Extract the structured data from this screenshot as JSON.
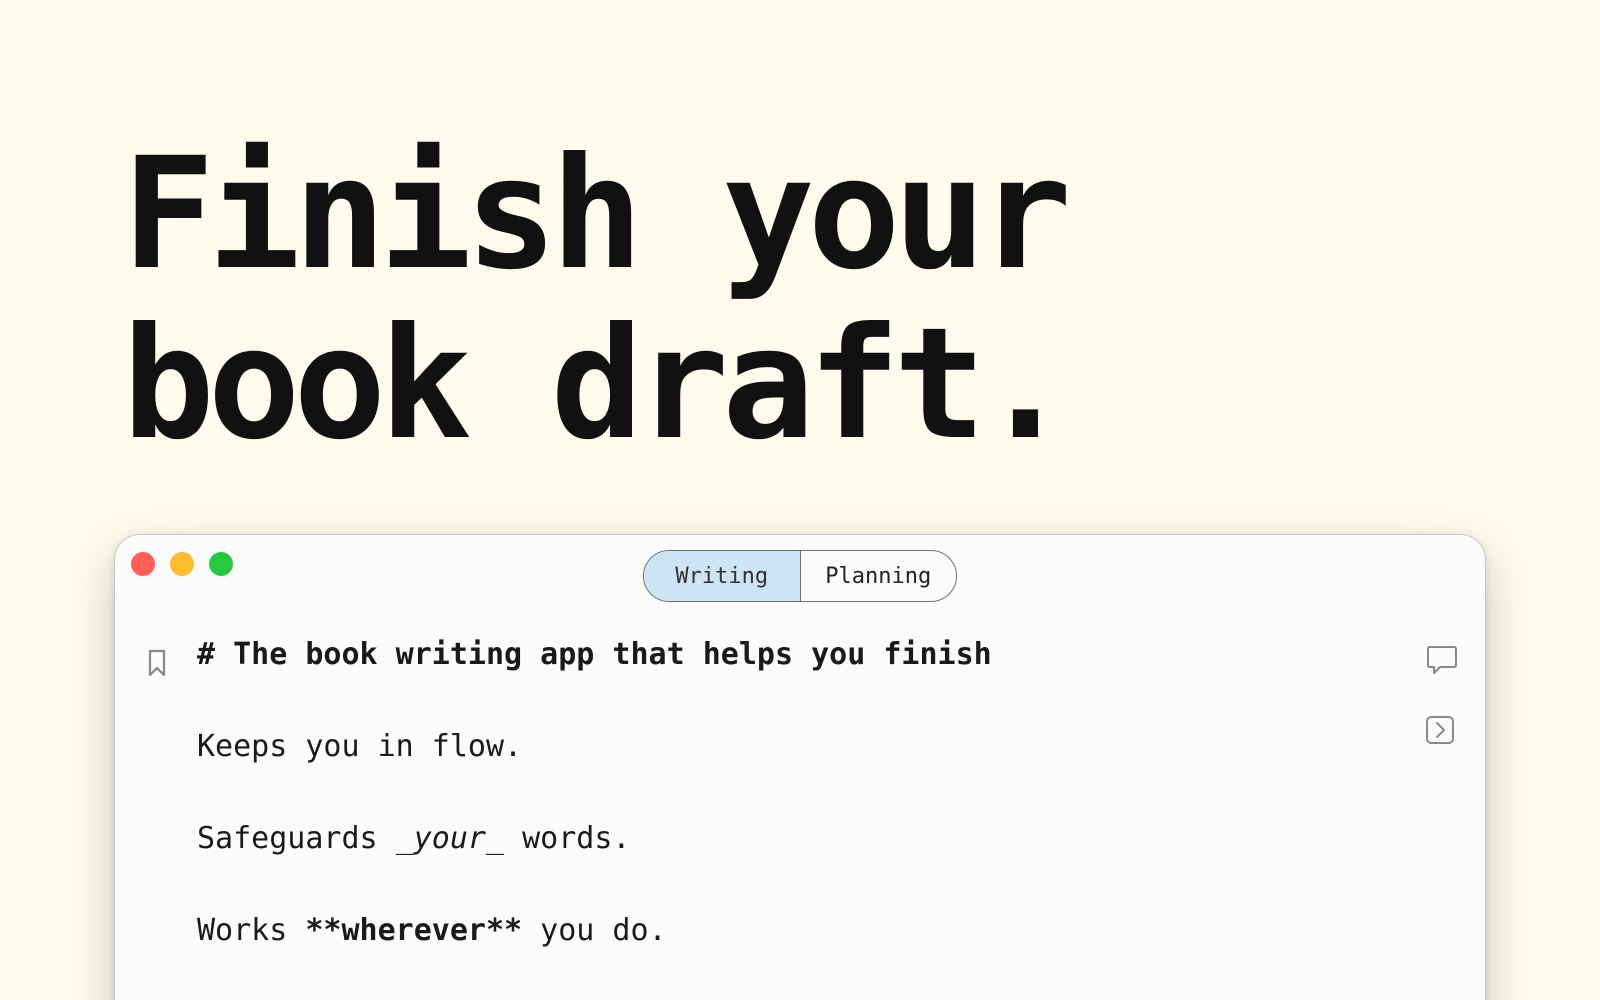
{
  "hero": {
    "line1": "Finish your",
    "line2": "book draft."
  },
  "window": {
    "tabs": [
      {
        "label": "Writing",
        "active": true
      },
      {
        "label": "Planning",
        "active": false
      }
    ],
    "traffic_colors": {
      "close": "#ff5f57",
      "minimize": "#febc2e",
      "zoom": "#28c840"
    },
    "active_tab_color": "#cde4f4",
    "editor": {
      "heading_marker": "#",
      "heading_text": "The book writing app that helps you finish",
      "line2": "Keeps you in flow.",
      "line3_prefix": "Safeguards ",
      "line3_emphasis": "_your_",
      "line3_suffix": " words.",
      "line4_prefix": "Works ",
      "line4_strong": "**wherever**",
      "line4_suffix": " you do."
    },
    "icons": [
      "bookmark-icon",
      "comment-icon",
      "expand-panel-icon"
    ]
  },
  "colors": {
    "page_background": "#fefbee",
    "text": "#111111"
  }
}
